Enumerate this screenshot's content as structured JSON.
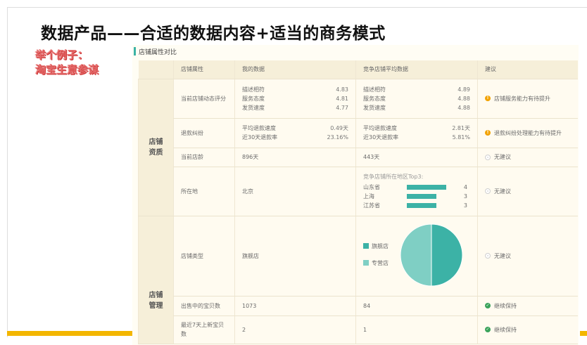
{
  "slide": {
    "title": "数据产品——合适的数据内容+适当的商务模式",
    "callout_line1": "举个例子：",
    "callout_line2": "淘宝生意参谋",
    "brand_color": "#f3b600"
  },
  "panel": {
    "title": "店铺属性对比",
    "accent_color": "#3bb3a5",
    "columns": [
      "店铺属性",
      "我的数据",
      "竞争店铺平均数据",
      "建议"
    ],
    "groups": [
      {
        "label_line1": "店铺",
        "label_line2": "资质"
      },
      {
        "label_line1": "店铺",
        "label_line2": "管理"
      }
    ],
    "rows": {
      "dsr": {
        "attr": "当前店铺动态评分",
        "mine": [
          {
            "k": "描述相符",
            "v": "4.83"
          },
          {
            "k": "服务态度",
            "v": "4.81"
          },
          {
            "k": "发货速度",
            "v": "4.77"
          }
        ],
        "avg": [
          {
            "k": "描述相符",
            "v": "4.89"
          },
          {
            "k": "服务态度",
            "v": "4.88"
          },
          {
            "k": "发货速度",
            "v": "4.88"
          }
        ],
        "advice": "店铺服务能力有待提升"
      },
      "refund": {
        "attr": "退款纠纷",
        "mine": [
          {
            "k": "平均退款速度",
            "v": "0.49天"
          },
          {
            "k": "近30天退款率",
            "v": "23.16%"
          }
        ],
        "avg": [
          {
            "k": "平均退款速度",
            "v": "2.81天"
          },
          {
            "k": "近30天退款率",
            "v": "5.81%"
          }
        ],
        "advice": "退款纠纷处理能力有待提升"
      },
      "age": {
        "attr": "当前店龄",
        "mine": "896天",
        "avg": "443天",
        "advice": "无建议"
      },
      "location": {
        "attr": "所在地",
        "mine": "北京",
        "avg_title": "竞争店铺所在地区Top3:",
        "avg_bars": [
          {
            "name": "山东省",
            "value": 4
          },
          {
            "name": "上海",
            "value": 3
          },
          {
            "name": "江苏省",
            "value": 3
          }
        ],
        "advice": "无建议"
      },
      "type": {
        "attr": "店铺类型",
        "mine": "旗舰店",
        "legend": [
          {
            "name": "旗舰店",
            "share": 0.5,
            "color": "#3cb2a6"
          },
          {
            "name": "专营店",
            "share": 0.5,
            "color": "#7fcfc4"
          }
        ],
        "advice": "无建议"
      },
      "items": {
        "attr": "出售中的宝贝数",
        "mine": "1073",
        "avg": "84",
        "advice": "继续保持"
      },
      "new_items": {
        "attr": "最近7天上新宝贝数",
        "mine": "2",
        "avg": "1",
        "advice": "继续保持"
      }
    },
    "bar_max": 4
  }
}
